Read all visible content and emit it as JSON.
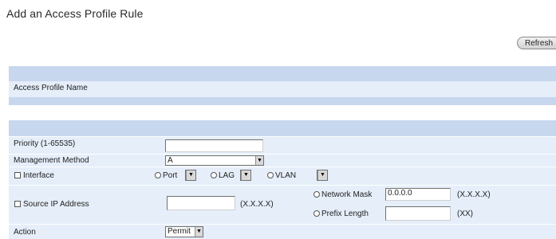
{
  "page": {
    "title": "Add an Access Profile Rule",
    "refresh_label": "Refresh"
  },
  "profile": {
    "name_label": "Access Profile Name"
  },
  "form": {
    "priority_label": "Priority (1-65535)",
    "priority_value": "",
    "management_method_label": "Management Method",
    "management_method_value": "A",
    "interface_label": "Interface",
    "port_label": "Port",
    "lag_label": "LAG",
    "vlan_label": "VLAN",
    "source_ip_label": "Source IP Address",
    "source_ip_value": "",
    "source_ip_format": "(X.X.X.X)",
    "network_mask_label": "Network Mask",
    "network_mask_value": "0.0.0.0",
    "network_mask_format": "(X.X.X.X)",
    "prefix_length_label": "Prefix Length",
    "prefix_length_value": "",
    "prefix_length_format": "(XX)",
    "action_label": "Action",
    "action_value": "Permit"
  },
  "icons": {
    "dropdown_arrow": "▼"
  }
}
